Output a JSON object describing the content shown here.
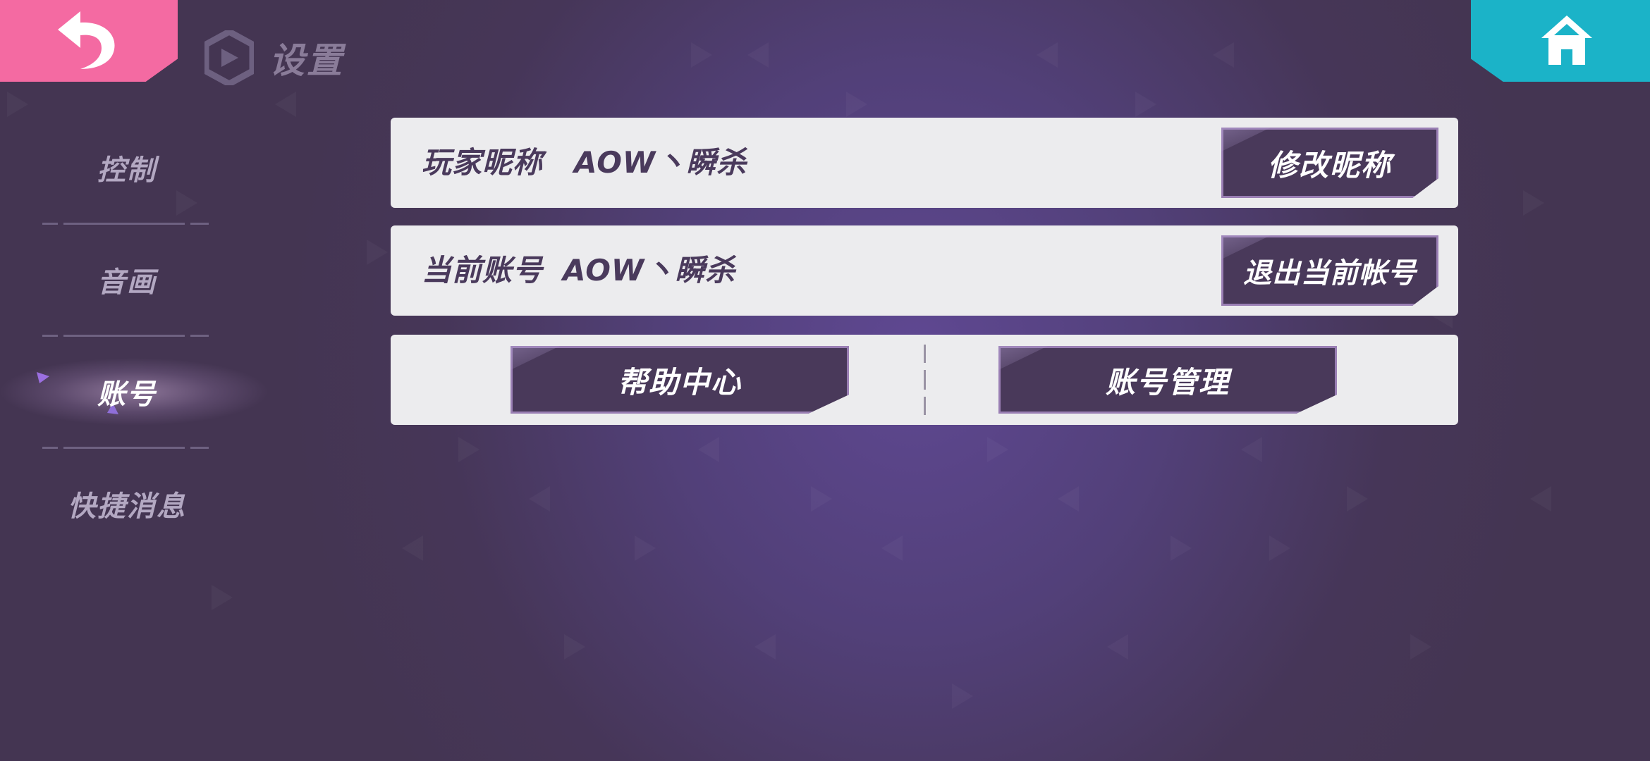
{
  "header": {
    "title": "设置",
    "back_icon": "back-arrow-icon",
    "home_icon": "home-icon",
    "logo_icon": "hexagon-logo-icon"
  },
  "colors": {
    "back": "#f46aa2",
    "home": "#1bb3c8",
    "button": "#49395a",
    "row": "#ececee",
    "accent": "#9a7fb4"
  },
  "sidebar": {
    "items": [
      {
        "label": "控制",
        "active": false
      },
      {
        "label": "音画",
        "active": false
      },
      {
        "label": "账号",
        "active": true
      },
      {
        "label": "快捷消息",
        "active": false
      }
    ]
  },
  "account": {
    "nickname_label": "玩家昵称",
    "nickname_value": "AOW丶瞬杀",
    "edit_nickname_button": "修改昵称",
    "current_account_label": "当前账号",
    "current_account_value": "AOW丶瞬杀",
    "logout_button": "退出当前帐号",
    "help_center_button": "帮助中心",
    "account_manage_button": "账号管理"
  }
}
